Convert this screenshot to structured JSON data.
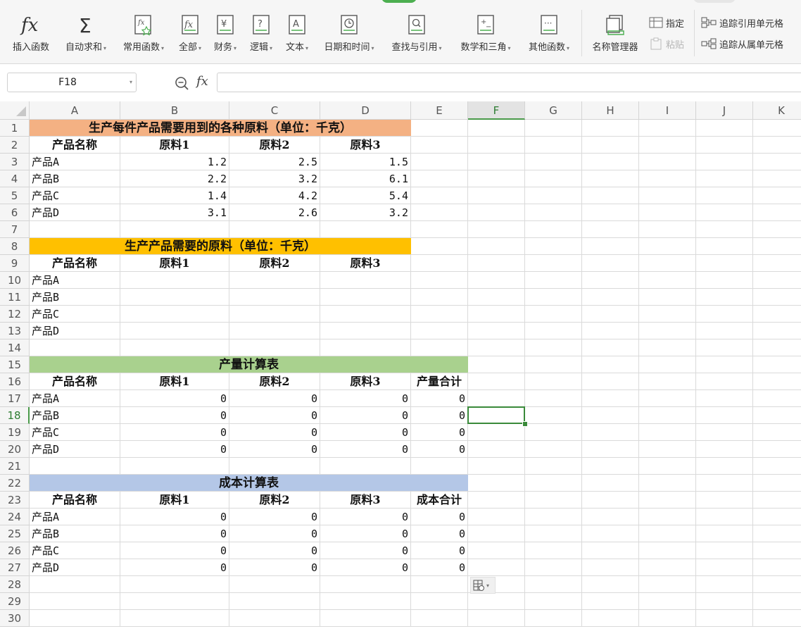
{
  "ribbon": {
    "buttons": [
      {
        "label": "插入函数",
        "icon": "fx-icon",
        "dropdown": false
      },
      {
        "label": "自动求和",
        "icon": "sigma-icon",
        "dropdown": true
      },
      {
        "label": "常用函数",
        "icon": "common-functions-icon",
        "dropdown": true
      },
      {
        "label": "全部",
        "icon": "all-functions-icon",
        "dropdown": true
      },
      {
        "label": "财务",
        "icon": "finance-icon",
        "dropdown": true
      },
      {
        "label": "逻辑",
        "icon": "logic-icon",
        "dropdown": true
      },
      {
        "label": "文本",
        "icon": "text-icon",
        "dropdown": true
      },
      {
        "label": "日期和时间",
        "icon": "datetime-icon",
        "dropdown": true
      },
      {
        "label": "查找与引用",
        "icon": "lookup-icon",
        "dropdown": true
      },
      {
        "label": "数学和三角",
        "icon": "math-icon",
        "dropdown": true
      },
      {
        "label": "其他函数",
        "icon": "other-functions-icon",
        "dropdown": true
      },
      {
        "label": "名称管理器",
        "icon": "name-manager-icon",
        "dropdown": false
      }
    ],
    "small": {
      "define": "指定",
      "paste": "粘贴",
      "trace_precedents": "追踪引用单元格",
      "trace_dependents": "追踪从属单元格"
    }
  },
  "formula_bar": {
    "name_box": "F18",
    "fx": "fx",
    "formula": ""
  },
  "columns": [
    "A",
    "B",
    "C",
    "D",
    "E",
    "F",
    "G",
    "H",
    "I",
    "J",
    "K"
  ],
  "selected_column": "F",
  "selected_row": 18,
  "rows": [
    "1",
    "2",
    "3",
    "4",
    "5",
    "6",
    "7",
    "8",
    "9",
    "10",
    "11",
    "12",
    "13",
    "14",
    "15",
    "16",
    "17",
    "18",
    "19",
    "20",
    "21",
    "22",
    "23",
    "24",
    "25",
    "26",
    "27",
    "28",
    "29",
    "30"
  ],
  "sheet": {
    "title1": "生产每件产品需要用到的各种原料（单位：千克）",
    "title2": "生产产品需要的原料（单位：千克）",
    "title3": "产量计算表",
    "title4": "成本计算表",
    "hdr_product": "产品名称",
    "hdr_m1": "原料1",
    "hdr_m2": "原料2",
    "hdr_m3": "原料3",
    "hdr_output_total": "产量合计",
    "hdr_cost_total": "成本合计",
    "table1": [
      {
        "name": "产品A",
        "m1": "1.2",
        "m2": "2.5",
        "m3": "1.5"
      },
      {
        "name": "产品B",
        "m1": "2.2",
        "m2": "3.2",
        "m3": "6.1"
      },
      {
        "name": "产品C",
        "m1": "1.4",
        "m2": "4.2",
        "m3": "5.4"
      },
      {
        "name": "产品D",
        "m1": "3.1",
        "m2": "2.6",
        "m3": "3.2"
      }
    ],
    "table2": [
      {
        "name": "产品A"
      },
      {
        "name": "产品B"
      },
      {
        "name": "产品C"
      },
      {
        "name": "产品D"
      }
    ],
    "table3": [
      {
        "name": "产品A",
        "m1": "0",
        "m2": "0",
        "m3": "0",
        "total": "0"
      },
      {
        "name": "产品B",
        "m1": "0",
        "m2": "0",
        "m3": "0",
        "total": "0"
      },
      {
        "name": "产品C",
        "m1": "0",
        "m2": "0",
        "m3": "0",
        "total": "0"
      },
      {
        "name": "产品D",
        "m1": "0",
        "m2": "0",
        "m3": "0",
        "total": "0"
      }
    ],
    "table4": [
      {
        "name": "产品A",
        "m1": "0",
        "m2": "0",
        "m3": "0",
        "total": "0"
      },
      {
        "name": "产品B",
        "m1": "0",
        "m2": "0",
        "m3": "0",
        "total": "0"
      },
      {
        "name": "产品C",
        "m1": "0",
        "m2": "0",
        "m3": "0",
        "total": "0"
      },
      {
        "name": "产品D",
        "m1": "0",
        "m2": "0",
        "m3": "0",
        "total": "0"
      }
    ]
  },
  "colors": {
    "title1_fill": "#F4B183",
    "title2_fill": "#FFC000",
    "title3_fill": "#A9D18E",
    "title4_fill": "#B4C7E7",
    "selection": "#3A8A3A"
  }
}
